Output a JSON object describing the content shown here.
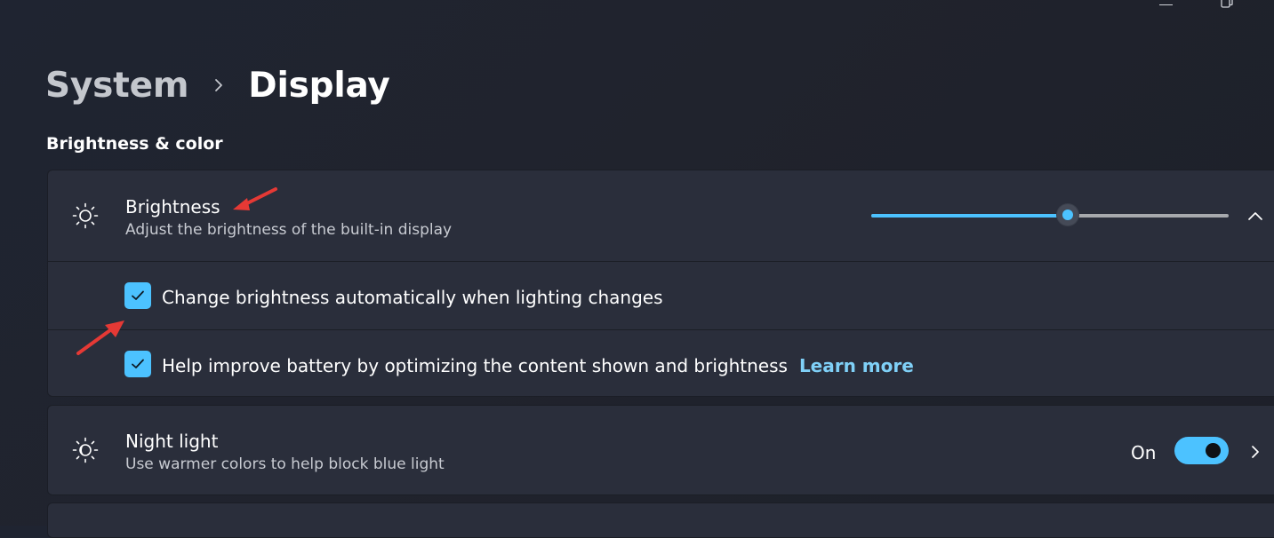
{
  "window": {
    "minimize_icon": "minimize-icon",
    "restore_icon": "restore-icon"
  },
  "breadcrumb": {
    "parent": "System",
    "separator_icon": "chevron-right-icon",
    "current": "Display"
  },
  "section": {
    "title": "Brightness & color"
  },
  "brightness": {
    "icon": "sun-icon",
    "title": "Brightness",
    "description": "Adjust the brightness of the built-in display",
    "slider_value_percent": 55,
    "expand_icon": "chevron-up-icon",
    "options": [
      {
        "label": "Change brightness automatically when lighting changes",
        "checked": true
      },
      {
        "label": "Help improve battery by optimizing the content shown and brightness",
        "checked": true,
        "link": "Learn more"
      }
    ]
  },
  "night_light": {
    "icon": "night-light-icon",
    "title": "Night light",
    "description": "Use warmer colors to help block blue light",
    "state_label": "On",
    "toggle_on": true,
    "nav_icon": "chevron-right-icon"
  },
  "colors": {
    "accent": "#4cc2ff",
    "link": "#7fd0f7",
    "card_background": "#2a2e3b",
    "page_background": "#20232d",
    "annotation_arrow": "#e53935"
  }
}
